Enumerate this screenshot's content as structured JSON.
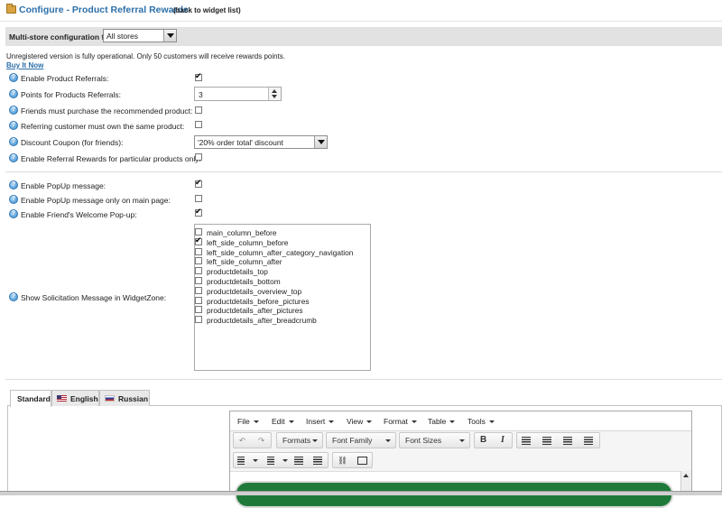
{
  "header": {
    "title": "Configure - Product Referral Rewards",
    "back_link": "(back to widget list)"
  },
  "store": {
    "label": "Multi-store configuration for",
    "selected": "All stores"
  },
  "notice": "Unregistered version is fully operational. Only 50 customers will receive rewards points.",
  "buy_link": "Buy It Now",
  "settings": {
    "enable_product_referrals": {
      "label": "Enable Product Referrals:",
      "checked": true
    },
    "points": {
      "label": "Points for Products Referrals:",
      "value": "3"
    },
    "friends_must_purchase": {
      "label": "Friends must purchase the recommended product:",
      "checked": false
    },
    "referring_must_own": {
      "label": "Referring customer must own the same product:",
      "checked": false
    },
    "discount_coupon": {
      "label": "Discount Coupon (for friends):",
      "selected": "'20% order total' discount"
    },
    "particular_products": {
      "label": "Enable Referral Rewards for particular products only:",
      "checked": false
    },
    "popup_message": {
      "label": "Enable PopUp message:",
      "checked": true
    },
    "popup_main_only": {
      "label": "Enable PopUp message only on main page:",
      "checked": false
    },
    "welcome_popup": {
      "label": "Enable Friend's Welcome Pop-up:",
      "checked": true
    },
    "widget_zone": {
      "label": "Show Solicitation Message in WidgetZone:"
    }
  },
  "widget_zones": [
    {
      "name": "main_column_before",
      "checked": false
    },
    {
      "name": "left_side_column_before",
      "checked": true
    },
    {
      "name": "left_side_column_after_category_navigation",
      "checked": false
    },
    {
      "name": "left_side_column_after",
      "checked": false
    },
    {
      "name": "productdetails_top",
      "checked": false
    },
    {
      "name": "productdetails_bottom",
      "checked": false
    },
    {
      "name": "productdetails_overview_top",
      "checked": false
    },
    {
      "name": "productdetails_before_pictures",
      "checked": false
    },
    {
      "name": "productdetails_after_pictures",
      "checked": false
    },
    {
      "name": "productdetails_after_breadcrumb",
      "checked": false
    }
  ],
  "tabs": [
    "Standard",
    "English",
    "Russian"
  ],
  "editor": {
    "menus": [
      "File",
      "Edit",
      "Insert",
      "View",
      "Format",
      "Table",
      "Tools"
    ],
    "formats_label": "Formats",
    "font_family_label": "Font Family",
    "font_sizes_label": "Font Sizes",
    "bold": "B",
    "italic": "I",
    "content_color": "#1f7a3a"
  }
}
